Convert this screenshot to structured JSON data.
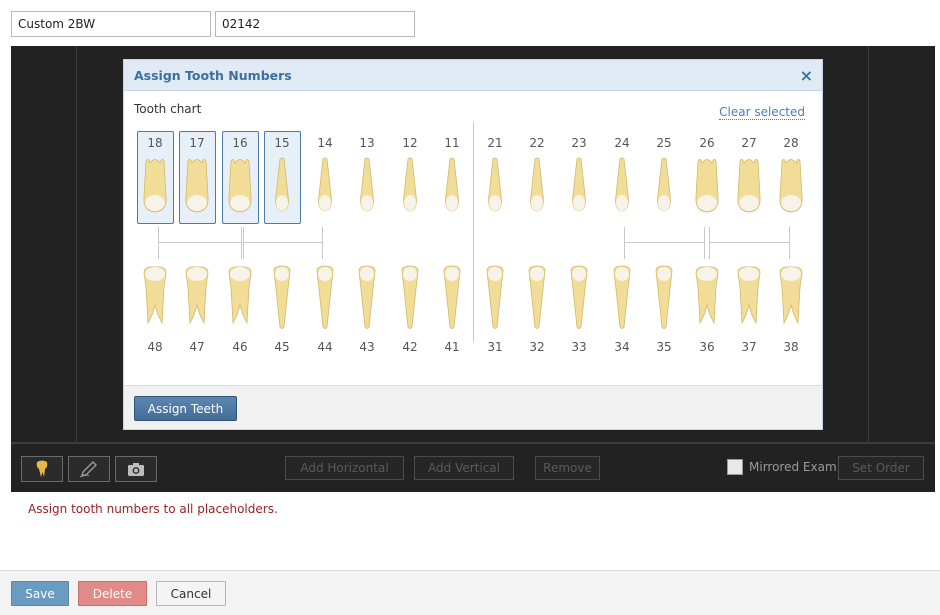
{
  "form": {
    "name_value": "Custom 2BW",
    "code_value": "02142"
  },
  "modal": {
    "title": "Assign Tooth Numbers",
    "close_glyph": "×",
    "chart_label": "Tooth chart",
    "clear_label": "Clear selected",
    "assign_label": "Assign Teeth"
  },
  "upper_teeth": [
    "18",
    "17",
    "16",
    "15",
    "14",
    "13",
    "12",
    "11",
    "21",
    "22",
    "23",
    "24",
    "25",
    "26",
    "27",
    "28"
  ],
  "lower_teeth": [
    "48",
    "47",
    "46",
    "45",
    "44",
    "43",
    "42",
    "41",
    "31",
    "32",
    "33",
    "34",
    "35",
    "36",
    "37",
    "38"
  ],
  "selected_teeth": [
    "18",
    "17",
    "16",
    "15"
  ],
  "toolbar": {
    "tooth_tool_icon": "tooth-icon",
    "draw_tool_icon": "pen-icon",
    "camera_tool_icon": "camera-icon",
    "add_horizontal_label": "Add Horizontal",
    "add_vertical_label": "Add Vertical",
    "remove_label": "Remove",
    "mirrored_label": "Mirrored Exam",
    "set_order_label": "Set Order"
  },
  "message": "Assign tooth numbers to all placeholders.",
  "footer": {
    "save_label": "Save",
    "delete_label": "Delete",
    "cancel_label": "Cancel"
  },
  "colors": {
    "save": "#6a9bc1",
    "delete": "#e08a8a",
    "accent": "#3d6f9f",
    "error": "#9a1f1f"
  }
}
